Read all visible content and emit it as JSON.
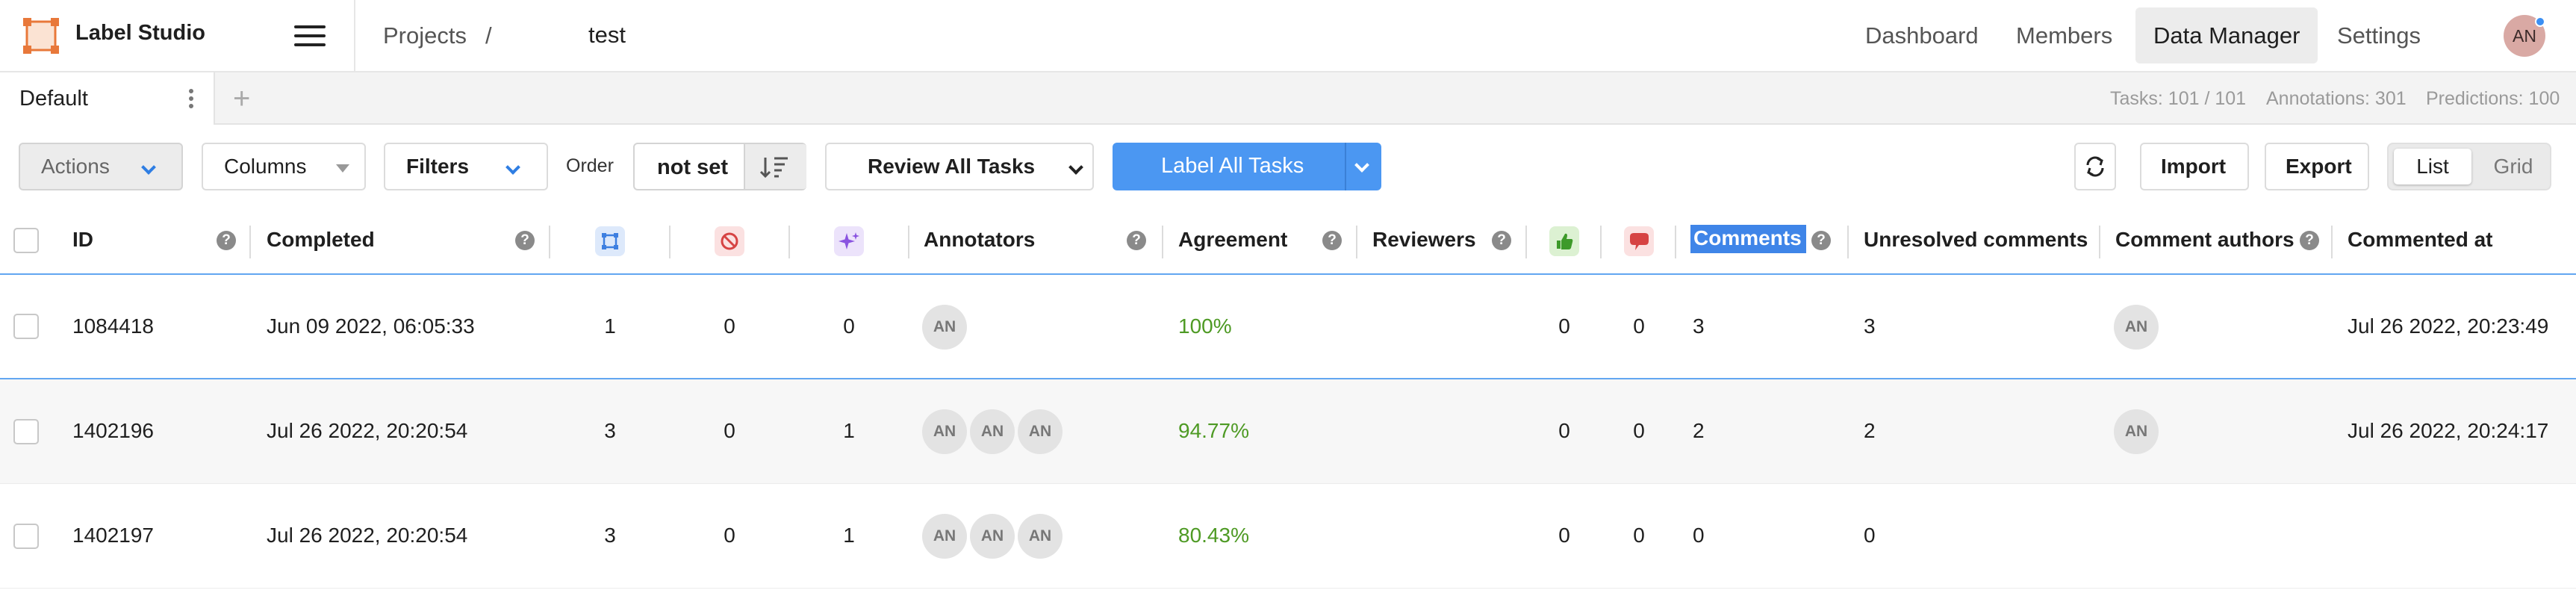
{
  "app": {
    "title": "Label Studio",
    "brand_color": "#e8783a"
  },
  "breadcrumb": {
    "projects": "Projects",
    "separator": "/",
    "current": "test"
  },
  "topnav": {
    "items": [
      "Dashboard",
      "Members",
      "Data Manager",
      "Settings"
    ],
    "active": "Data Manager",
    "avatar": "AN"
  },
  "tabs": {
    "active_tab": "Default",
    "add_icon": "+"
  },
  "stats": {
    "tasks": "Tasks: 101 / 101",
    "annotations": "Annotations: 301",
    "predictions": "Predictions: 100"
  },
  "toolbar": {
    "actions": "Actions",
    "columns": "Columns",
    "filters": "Filters",
    "order_label": "Order",
    "order_value": "not set",
    "review_all": "Review All Tasks",
    "label_all": "Label All Tasks",
    "import": "Import",
    "export": "Export",
    "view_list": "List",
    "view_grid": "Grid",
    "accent_color": "#4b97f2"
  },
  "table": {
    "columns": {
      "id": "ID",
      "completed": "Completed",
      "annotators": "Annotators",
      "agreement": "Agreement",
      "reviewers": "Reviewers",
      "comments": "Comments",
      "unresolved_comments": "Unresolved comments",
      "comment_authors": "Comment authors",
      "commented_at": "Commented at"
    },
    "help_glyph": "?",
    "rows": [
      {
        "id": "1084418",
        "completed": "Jun 09 2022, 06:05:33",
        "total_annotations": "1",
        "cancelled": "0",
        "predictions": "0",
        "annotators": [
          "AN"
        ],
        "agreement": "100%",
        "reviews_accepted": "0",
        "reviews_rejected": "0",
        "comments": "3",
        "unresolved_comments": "3",
        "comment_authors": [
          "AN"
        ],
        "commented_at": "Jul 26 2022, 20:23:49"
      },
      {
        "id": "1402196",
        "completed": "Jul 26 2022, 20:20:54",
        "total_annotations": "3",
        "cancelled": "0",
        "predictions": "1",
        "annotators": [
          "AN",
          "AN",
          "AN"
        ],
        "agreement": "94.77%",
        "reviews_accepted": "0",
        "reviews_rejected": "0",
        "comments": "2",
        "unresolved_comments": "2",
        "comment_authors": [
          "AN"
        ],
        "commented_at": "Jul 26 2022, 20:24:17"
      },
      {
        "id": "1402197",
        "completed": "Jul 26 2022, 20:20:54",
        "total_annotations": "3",
        "cancelled": "0",
        "predictions": "1",
        "annotators": [
          "AN",
          "AN",
          "AN"
        ],
        "agreement": "80.43%",
        "reviews_accepted": "0",
        "reviews_rejected": "0",
        "comments": "0",
        "unresolved_comments": "0",
        "comment_authors": [],
        "commented_at": ""
      }
    ]
  }
}
